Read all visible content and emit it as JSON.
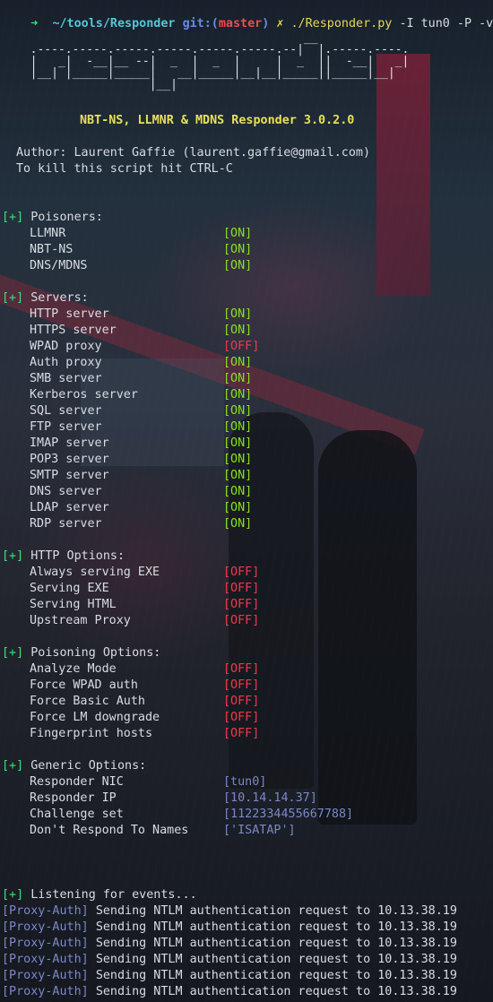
{
  "prompt": {
    "arrow": "➜",
    "cwd": "~/tools/Responder",
    "git_label": "git:(",
    "branch": "master",
    "git_close": ")",
    "dirty": "✗",
    "command": "./Responder.py",
    "args": "-I tun0 -P -v"
  },
  "banner": {
    "ascii_art": "                                         __\n  .----.-----.-----.-----.-----.-----.--|  |.-----.----.\n  |   _|  -__|__ --|  _  |  _  |     |  _  ||  -__|   _|\n  |__| |_____|_____|   __|_____|__|__|_____||_____|__|\n                   |__|",
    "title": "NBT-NS, LLMNR & MDNS Responder 3.0.2.0",
    "author_line": "Author: Laurent Gaffie (laurent.gaffie@gmail.com)",
    "kill_line": "To kill this script hit CTRL-C"
  },
  "sections": {
    "poisoners": {
      "marker": "[+]",
      "title": "Poisoners:",
      "items": [
        {
          "label": "LLMNR",
          "value": "[ON]"
        },
        {
          "label": "NBT-NS",
          "value": "[ON]"
        },
        {
          "label": "DNS/MDNS",
          "value": "[ON]"
        }
      ]
    },
    "servers": {
      "marker": "[+]",
      "title": "Servers:",
      "items": [
        {
          "label": "HTTP server",
          "value": "[ON]"
        },
        {
          "label": "HTTPS server",
          "value": "[ON]"
        },
        {
          "label": "WPAD proxy",
          "value": "[OFF]"
        },
        {
          "label": "Auth proxy",
          "value": "[ON]"
        },
        {
          "label": "SMB server",
          "value": "[ON]"
        },
        {
          "label": "Kerberos server",
          "value": "[ON]"
        },
        {
          "label": "SQL server",
          "value": "[ON]"
        },
        {
          "label": "FTP server",
          "value": "[ON]"
        },
        {
          "label": "IMAP server",
          "value": "[ON]"
        },
        {
          "label": "POP3 server",
          "value": "[ON]"
        },
        {
          "label": "SMTP server",
          "value": "[ON]"
        },
        {
          "label": "DNS server",
          "value": "[ON]"
        },
        {
          "label": "LDAP server",
          "value": "[ON]"
        },
        {
          "label": "RDP server",
          "value": "[ON]"
        }
      ]
    },
    "http_options": {
      "marker": "[+]",
      "title": "HTTP Options:",
      "items": [
        {
          "label": "Always serving EXE",
          "value": "[OFF]"
        },
        {
          "label": "Serving EXE",
          "value": "[OFF]"
        },
        {
          "label": "Serving HTML",
          "value": "[OFF]"
        },
        {
          "label": "Upstream Proxy",
          "value": "[OFF]"
        }
      ]
    },
    "poisoning_options": {
      "marker": "[+]",
      "title": "Poisoning Options:",
      "items": [
        {
          "label": "Analyze Mode",
          "value": "[OFF]"
        },
        {
          "label": "Force WPAD auth",
          "value": "[OFF]"
        },
        {
          "label": "Force Basic Auth",
          "value": "[OFF]"
        },
        {
          "label": "Force LM downgrade",
          "value": "[OFF]"
        },
        {
          "label": "Fingerprint hosts",
          "value": "[OFF]"
        }
      ]
    },
    "generic_options": {
      "marker": "[+]",
      "title": "Generic Options:",
      "items": [
        {
          "label": "Responder NIC",
          "value": "[tun0]"
        },
        {
          "label": "Responder IP",
          "value": "[10.14.14.37]"
        },
        {
          "label": "Challenge set",
          "value": "[1122334455667788]"
        },
        {
          "label": "Don't Respond To Names",
          "value": "['ISATAP']"
        }
      ]
    }
  },
  "listening": {
    "marker": "[+]",
    "text": "Listening for events..."
  },
  "log": [
    {
      "tag": "[Proxy-Auth]",
      "message": "Sending NTLM authentication request to 10.13.38.19"
    },
    {
      "tag": "[Proxy-Auth]",
      "message": "Sending NTLM authentication request to 10.13.38.19"
    },
    {
      "tag": "[Proxy-Auth]",
      "message": "Sending NTLM authentication request to 10.13.38.19"
    },
    {
      "tag": "[Proxy-Auth]",
      "message": "Sending NTLM authentication request to 10.13.38.19"
    },
    {
      "tag": "[Proxy-Auth]",
      "message": "Sending NTLM authentication request to 10.13.38.19"
    },
    {
      "tag": "[Proxy-Auth]",
      "message": "Sending NTLM authentication request to 10.13.38.19"
    }
  ],
  "colors": {
    "on": "#86e01f",
    "off": "#f0384a",
    "option_value": "#7b88c8",
    "marker": "#3ce07a",
    "title": "#e8e05a"
  }
}
